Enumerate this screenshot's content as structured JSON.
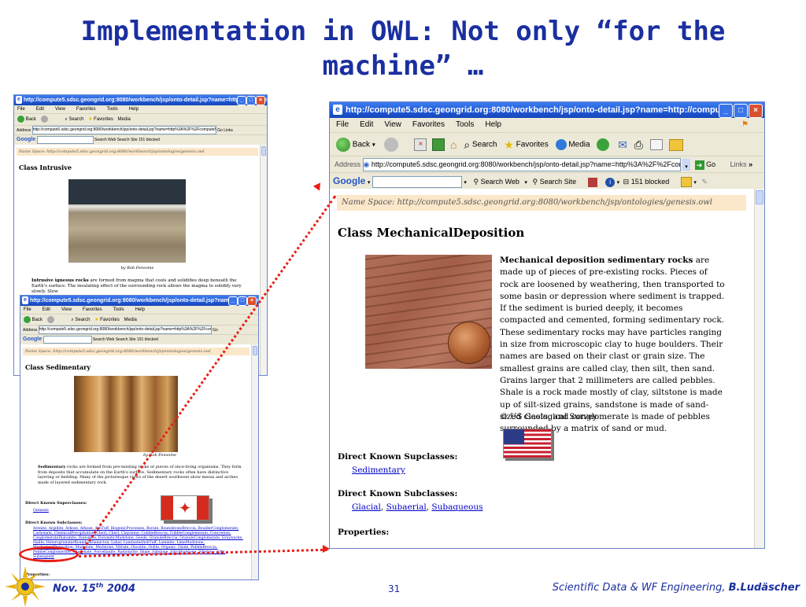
{
  "slide": {
    "title_line1": "Implementation in OWL: Not only “for the",
    "title_line2": "machine” …"
  },
  "browser": {
    "title": "http://compute5.sdsc.geongrid.org:8080/workbench/jsp/onto-detail.jsp?name=http://compute5.sd...",
    "address_label": "Address",
    "address_value": "http://compute5.sdsc.geongrid.org:8080/workbench/jsp/onto-detail.jsp?name=http%3A%2F%2Fcompute5.s",
    "go_label": "Go",
    "links_label": "Links",
    "menu": [
      "File",
      "Edit",
      "View",
      "Favorites",
      "Tools",
      "Help"
    ],
    "toolbar": {
      "back": "Back",
      "search": "Search",
      "favorites": "Favorites",
      "media": "Media"
    },
    "google": {
      "logo": "Google",
      "search_web": "Search Web",
      "search_site": "Search Site",
      "blocked": "151 blocked"
    },
    "namespace": "Name Space: http://compute5.sdsc.geongrid.org:8080/workbench/jsp/ontologies/genesis.owl"
  },
  "intrusive": {
    "heading": "Class Intrusive",
    "caption": "by Rob Fensome",
    "text_bold": "Intrusive igneous rocks",
    "text": "are formed from magma that cools and solidifies deep beneath the Earth's surface. The insulating effect of the surrounding rock allows the magma to solidify very slowly. Slow"
  },
  "sedimentary": {
    "heading": "Class Sedimentary",
    "caption": "by Rob Fensome",
    "text_bold": "Sedimentary",
    "text": "rocks are formed from pre-existing rocks or pieces of once-living organisms. They form from deposits that accumulate on the Earth's surface. Sedimentary rocks often have distinctive layering or bedding. Many of the picturesque views of the desert southwest show mesas and arches made of layered sedimentary rock.",
    "superclasses_label": "Direct Known Superclasses:",
    "superclasses": [
      "Genesis"
    ],
    "subclasses_label": "Direct Known Subclasses:",
    "subclasses_text": "Arenite, Argillite, Arkose, Arkose, AshTuff, BiogenicProcesses, Borate, BoundstoneBreccia, BoulderConglomerate, Carbonate, ChemicalPrecipitation, Chert, Chert, Claystone, CobbleBreccia, CobbleConglomerate, Concretion, ConglomerateDiatomite, Diatomite, DolomiticMudstone, Geode, GranuleBreccia, GranuleConglomerate, Graywacke, Halite, HeterogranularRoundedDiamicton, Lahar, LaminatedAshTuff, Laminite, LimeMudstone, MechanicalDeposition, Mudstone, Mudstone, Nitrate, Oncolite, Oolite, Organic, Oxide, PebbleBreccia, PebbleConglomerate, Phosphate, Porcellanite, Radiolarite, Shale, Siltstone, SiltyMudstone, Siltstone, Silty, Subsequent",
    "properties_label": "Properties:"
  },
  "mechanical": {
    "heading": "Class MechanicalDeposition",
    "text_bold": "Mechanical deposition sedimentary rocks",
    "text": "are made up of pieces of pre-existing rocks. Pieces of rock are loosened by weathering, then transported to some basin or depression where sediment is trapped. If the sediment is buried deeply, it becomes compacted and cemented, forming sedimentary rock. These sedimentary rocks may have particles ranging in size from microscopic clay to huge boulders. Their names are based on their clast or grain size. The smallest grains are called clay, then silt, then sand. Grains larger that 2 millimeters are called pebbles. Shale is a rock made mostly of clay, siltstone is made up of silt-sized grains, sandstone is made of sand-sized clasts, and conglomerate is made of pebbles surrounded by a matrix of sand or mud.",
    "credit": "© US Geological Survey",
    "superclasses_label": "Direct Known Supclasses:",
    "superclasses": [
      "Sedimentary"
    ],
    "subclasses_label": "Direct Known Subclasses:",
    "subclasses": [
      "Glacial",
      "Subaerial",
      "Subaqueous"
    ],
    "properties_label": "Properties:"
  },
  "footer": {
    "date_prefix": "Nov. 15",
    "date_sup": "th",
    "date_suffix": " 2004",
    "page": "31",
    "credit_prefix": "Scientific Data & WF Engineering, ",
    "credit_author": "B.Ludäscher"
  },
  "colors": {
    "title": "#1a2fa0",
    "accent_dots": "#e81e16",
    "titlebar": "#1f57d6"
  }
}
